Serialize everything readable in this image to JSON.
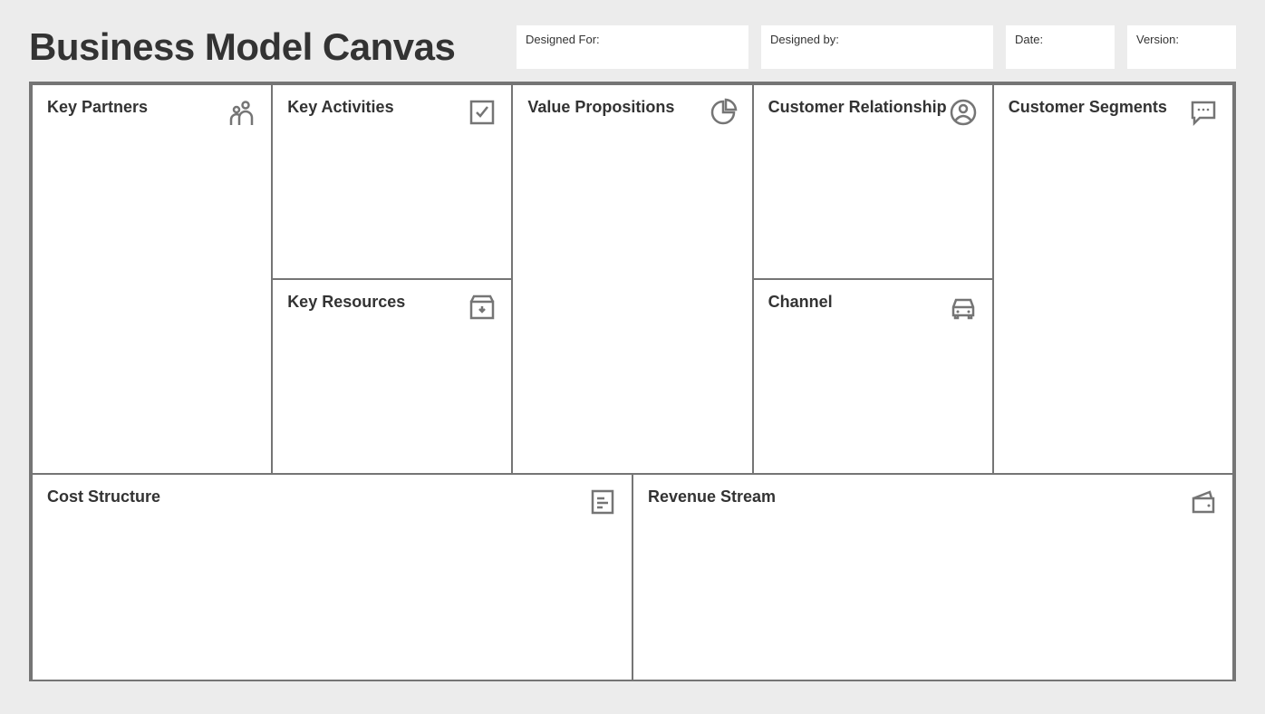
{
  "title": "Business Model Canvas",
  "meta": {
    "designed_for_label": "Designed For:",
    "designed_by_label": "Designed by:",
    "date_label": "Date:",
    "version_label": "Version:"
  },
  "cells": {
    "key_partners": "Key Partners",
    "key_activities": "Key Activities",
    "key_resources": "Key Resources",
    "value_propositions": "Value Propositions",
    "customer_relationship": "Customer Relationship",
    "channel": "Channel",
    "customer_segments": "Customer Segments",
    "cost_structure": "Cost Structure",
    "revenue_stream": "Revenue Stream"
  }
}
